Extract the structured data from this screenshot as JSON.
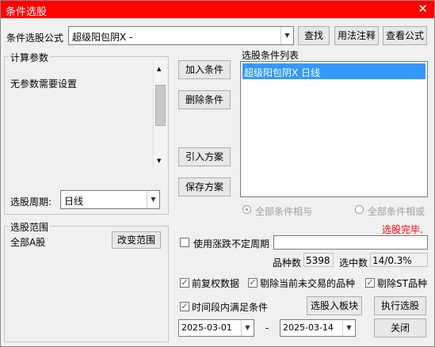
{
  "window": {
    "title": "条件选股",
    "close_glyph": "✕"
  },
  "top": {
    "formula_label": "条件选股公式",
    "formula_value": "超级阳包阴X  -",
    "btn_find": "查找",
    "btn_usage": "用法注释",
    "btn_view": "查看公式"
  },
  "params": {
    "group_label": "计算参数",
    "text": "无参数需要设置",
    "period_label": "选股周期:",
    "period_value": "日线"
  },
  "middle": {
    "btn_add": "加入条件",
    "btn_delete": "删除条件",
    "btn_import": "引入方案",
    "btn_save": "保存方案"
  },
  "conditions": {
    "label": "选股条件列表",
    "items": [
      "超级阳包阴X  日线"
    ],
    "radio_and": "全部条件相与",
    "radio_or": "全部条件相或"
  },
  "range": {
    "group_label": "选股范围",
    "value": "全部A股",
    "btn_change": "改变范围"
  },
  "status": {
    "done_text": "选股完毕.",
    "use_period_label": "使用涨跌不定周期",
    "count_label": "品种数",
    "count_value": "5398",
    "selected_label": "选中数",
    "selected_value": "14/0.3%"
  },
  "options": {
    "rights": "前复权数据",
    "exclude_untraded": "剔除当前未交易的品种",
    "exclude_st": "剔除ST品种",
    "time_range": "时间段内满足条件"
  },
  "actions": {
    "btn_to_block": "选股入板块",
    "btn_execute": "执行选股",
    "btn_close": "关闭"
  },
  "dates": {
    "start": "2025-03-01",
    "separator": "-",
    "end": "2025-03-14"
  },
  "colors": {
    "title_bar": "#ff0000",
    "selection": "#3399ff",
    "done_text": "#ff0000"
  },
  "icons": {
    "close": "close-icon",
    "dropdown": "chevron-down-icon",
    "checkmark": "check-icon"
  }
}
